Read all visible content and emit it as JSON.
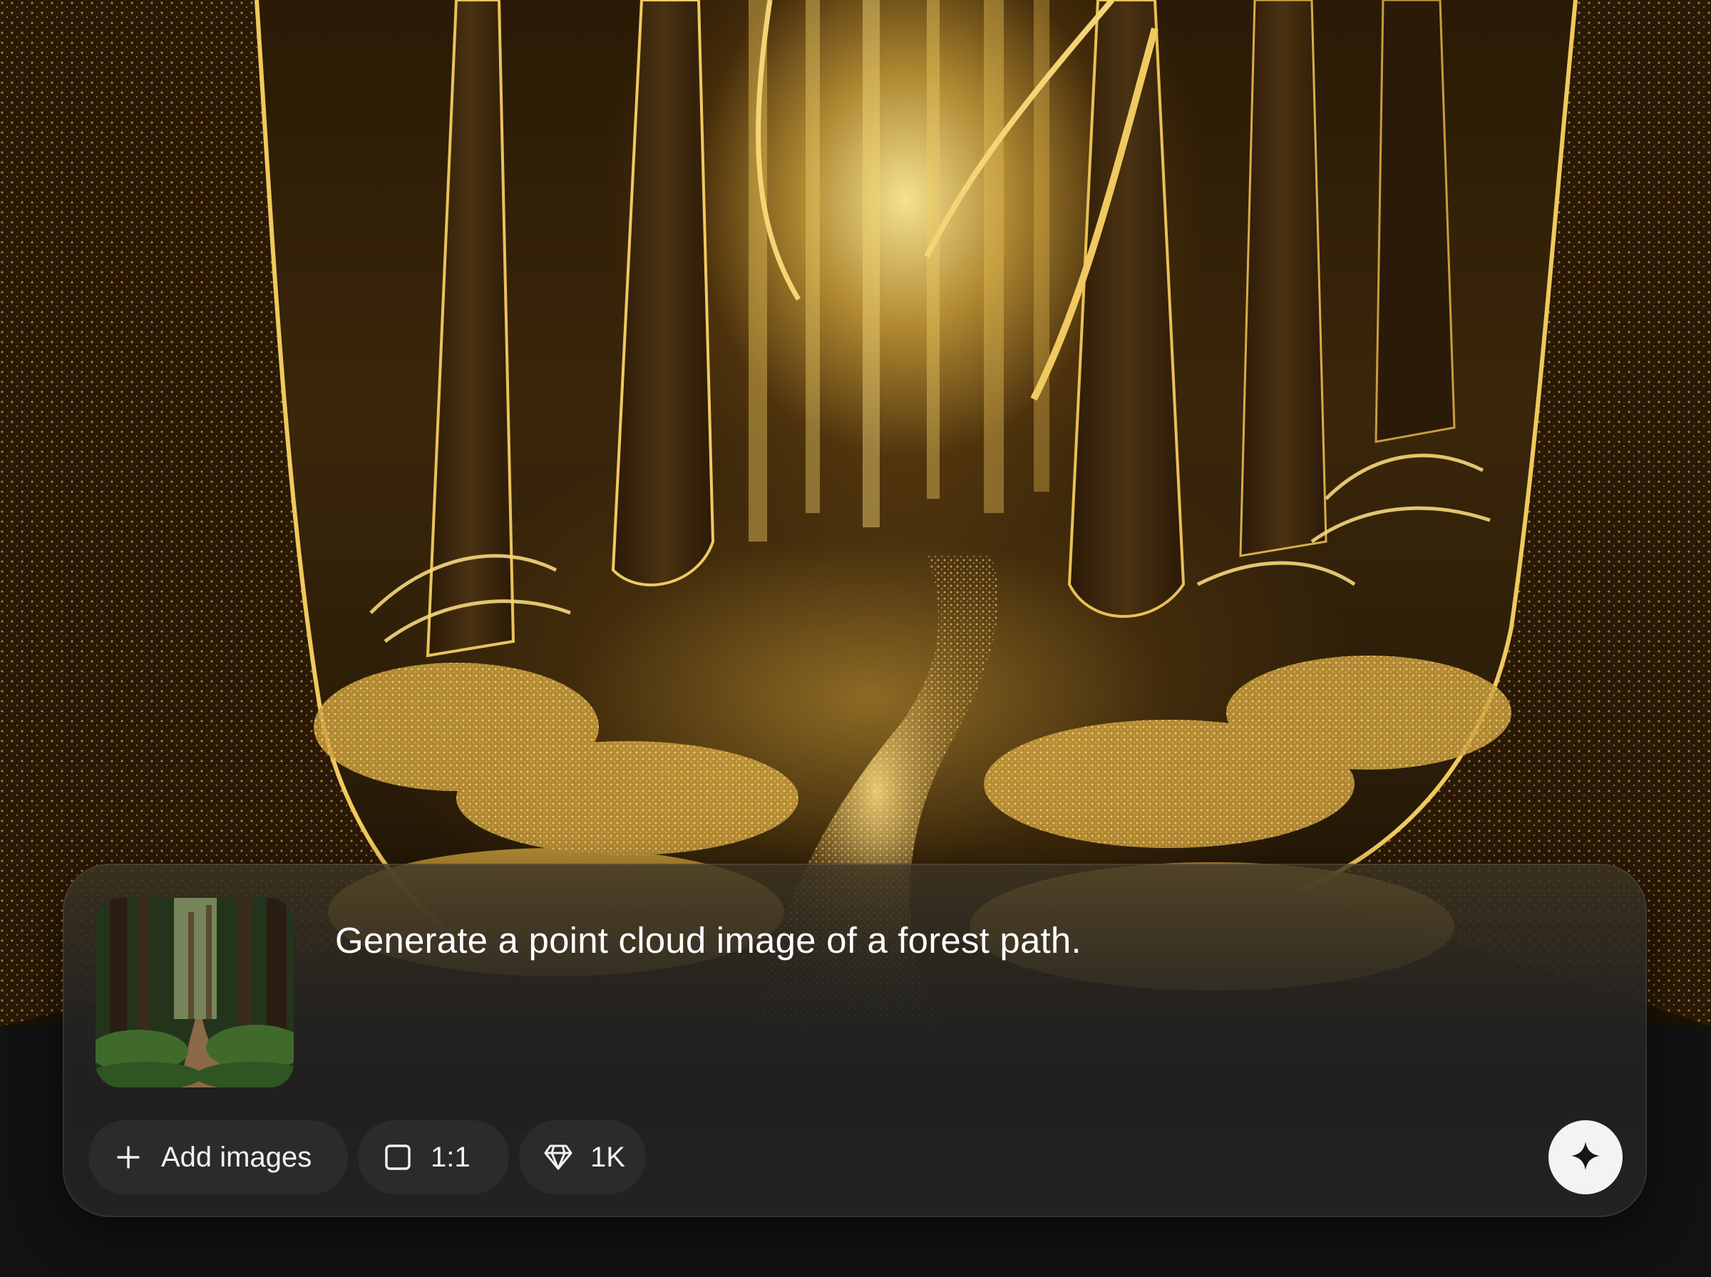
{
  "composer": {
    "prompt_text": "Generate a point cloud image of a forest path.",
    "toolbar": {
      "add_images_label": "Add images",
      "aspect_ratio_label": "1:1",
      "quality_label": "1K"
    },
    "icons": {
      "add": "plus-icon",
      "aspect_ratio": "square-icon",
      "quality": "diamond-icon",
      "submit": "sparkle-icon"
    }
  },
  "colors": {
    "page_background": "#121212",
    "composer_background": "#222222",
    "chip_background": "#2b2b2b",
    "submit_button": "#f3f3f3",
    "accent_gold": "#e8c24a"
  }
}
